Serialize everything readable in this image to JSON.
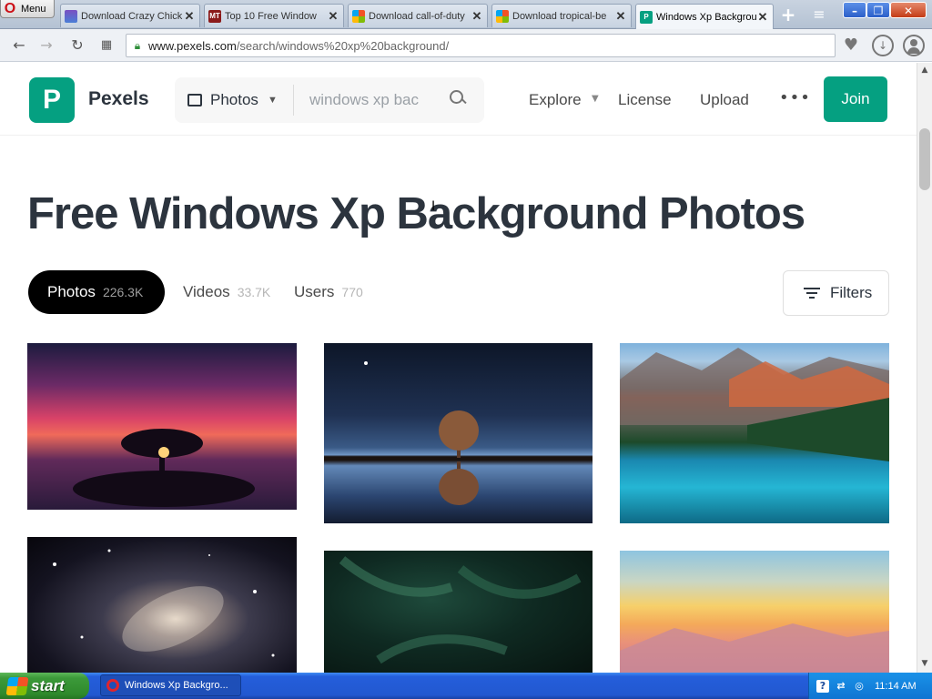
{
  "browser": {
    "menu_label": "Menu",
    "tabs": [
      {
        "label": "Download Crazy Chick",
        "favicon": "game-favicon"
      },
      {
        "label": "Top 10 Free Window",
        "favicon": "mt-favicon"
      },
      {
        "label": "Download call-of-duty",
        "favicon": "windows-favicon"
      },
      {
        "label": "Download tropical-be",
        "favicon": "windows-favicon"
      },
      {
        "label": "Windows Xp Backgrou",
        "favicon": "pexels-favicon",
        "active": true
      }
    ],
    "url_host": "www.pexels.com",
    "url_path": "/search/windows%20xp%20background/"
  },
  "header": {
    "logo_text": "Pexels",
    "search_type": "Photos",
    "search_value": "windows xp bac",
    "nav": {
      "explore": "Explore",
      "license": "License",
      "upload": "Upload"
    },
    "join_label": "Join"
  },
  "main": {
    "title": "Free Windows Xp Background Photos",
    "media_tabs": [
      {
        "label": "Photos",
        "count": "226.3K",
        "active": true
      },
      {
        "label": "Videos",
        "count": "33.7K"
      },
      {
        "label": "Users",
        "count": "770"
      }
    ],
    "filters_label": "Filters"
  },
  "taskbar": {
    "start_label": "start",
    "task_label": "Windows Xp Backgro...",
    "clock": "11:14 AM"
  },
  "colors": {
    "pexels_green": "#05a081",
    "text_dark": "#2c343e"
  }
}
